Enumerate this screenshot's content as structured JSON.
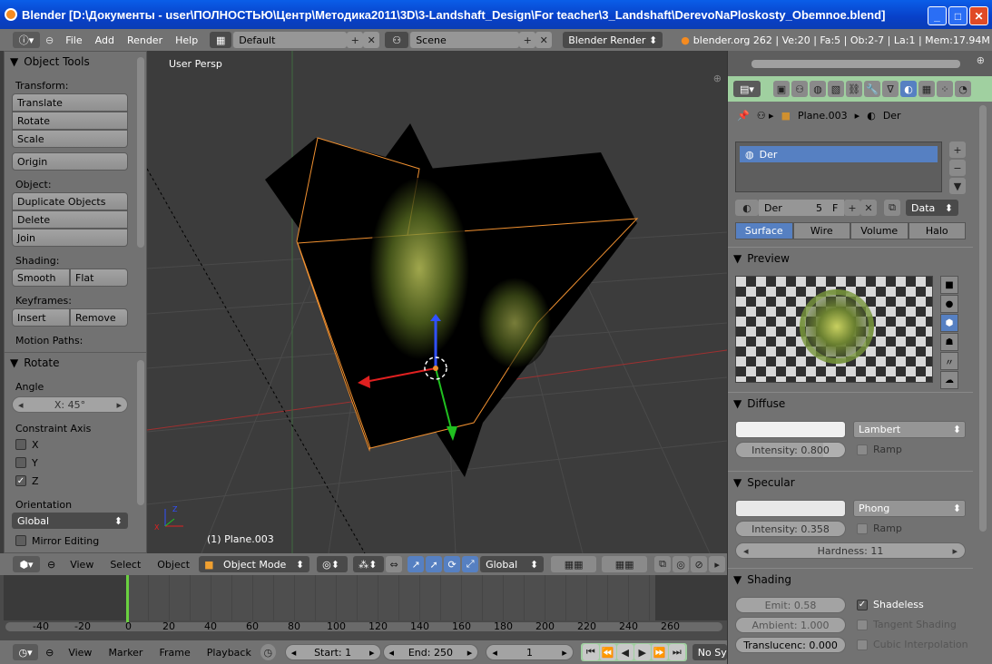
{
  "window": {
    "title": "Blender [D:\\Документы - user\\ПОЛНОСТЬЮ\\Центр\\Методика2011\\3D\\3-Landshaft_Design\\For teacher\\3_Landshaft\\DerevoNaPloskosty_Obemnoe.blend]",
    "minimize": "_",
    "maximize": "□",
    "close": "✕"
  },
  "menubar": {
    "items": [
      "File",
      "Add",
      "Render",
      "Help"
    ],
    "screen_layout": "Default",
    "scene": "Scene",
    "render_engine": "Blender Render",
    "stats": "blender.org 262 | Ve:20 | Fa:5 | Ob:2-7 | La:1 | Mem:17.94M"
  },
  "toolshelf": {
    "title": "Object Tools",
    "transform_label": "Transform:",
    "transform_buttons": [
      "Translate",
      "Rotate",
      "Scale"
    ],
    "origin_button": "Origin",
    "object_label": "Object:",
    "object_buttons": [
      "Duplicate Objects",
      "Delete",
      "Join"
    ],
    "shading_label": "Shading:",
    "smooth": "Smooth",
    "flat": "Flat",
    "keyframes_label": "Keyframes:",
    "insert": "Insert",
    "remove": "Remove",
    "motion_paths_label": "Motion Paths:",
    "operator_title": "Rotate",
    "angle_label": "Angle",
    "angle_value": "X: 45°",
    "constraint_label": "Constraint Axis",
    "axes": [
      {
        "label": "X",
        "checked": false
      },
      {
        "label": "Y",
        "checked": false
      },
      {
        "label": "Z",
        "checked": true
      }
    ],
    "orientation_label": "Orientation",
    "orientation_value": "Global",
    "mirror_editing": "Mirror Editing"
  },
  "viewport": {
    "view_label": "User Persp",
    "object_label": "(1) Plane.003"
  },
  "viewport_header": {
    "menus": [
      "View",
      "Select",
      "Object"
    ],
    "mode": "Object Mode",
    "orientation": "Global"
  },
  "timeline": {
    "ticks": [
      "-40",
      "-20",
      "0",
      "20",
      "40",
      "60",
      "80",
      "100",
      "120",
      "140",
      "160",
      "180",
      "200",
      "220",
      "240",
      "260"
    ],
    "menus": [
      "View",
      "Marker",
      "Frame",
      "Playback"
    ],
    "start": "Start: 1",
    "end": "End: 250",
    "current": "1",
    "sync": "No Sync"
  },
  "properties": {
    "breadcrumb_object": "Plane.003",
    "breadcrumb_material": "Der",
    "material_slot": "Der",
    "material_name": "Der",
    "users": "5",
    "fake": "F",
    "link": "Data",
    "tabs": [
      "Surface",
      "Wire",
      "Volume",
      "Halo"
    ],
    "active_tab": "Surface",
    "preview_title": "Preview",
    "diffuse": {
      "title": "Diffuse",
      "shader": "Lambert",
      "intensity": "Intensity: 0.800",
      "intensity_value": 0.8,
      "ramp": "Ramp"
    },
    "specular": {
      "title": "Specular",
      "shader": "Phong",
      "intensity": "Intensity: 0.358",
      "intensity_value": 0.358,
      "ramp": "Ramp",
      "hardness": "Hardness: 11"
    },
    "shading": {
      "title": "Shading",
      "emit": "Emit: 0.58",
      "ambient": "Ambient: 1.000",
      "translucency": "Translucenc: 0.000",
      "shadeless": "Shadeless",
      "shadeless_checked": true,
      "tangent": "Tangent Shading",
      "cubic": "Cubic Interpolation"
    }
  },
  "colors": {
    "accent": "#5680c2",
    "header": "#727272",
    "viewport_bg": "#3c3c3c",
    "selection_outline": "#f09030"
  }
}
